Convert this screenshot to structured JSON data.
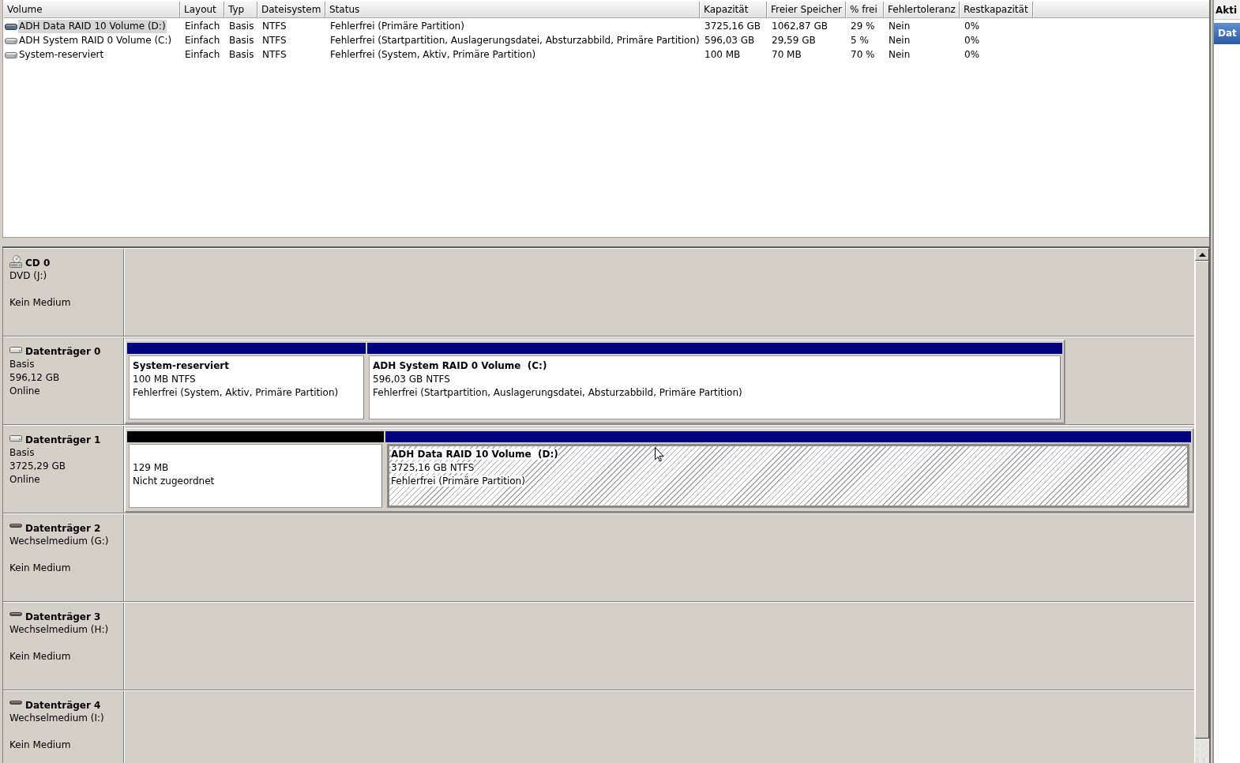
{
  "volume_list": {
    "columns": [
      "Volume",
      "Layout",
      "Typ",
      "Dateisystem",
      "Status",
      "Kapazität",
      "Freier Speicher",
      "% frei",
      "Fehlertoleranz",
      "Restkapazität"
    ],
    "rows": [
      {
        "selected": true,
        "cells": [
          "ADH Data RAID 10 Volume (D:)",
          "Einfach",
          "Basis",
          "NTFS",
          "Fehlerfrei (Primäre Partition)",
          "3725,16 GB",
          "1062,87 GB",
          "29 %",
          "Nein",
          "0%"
        ]
      },
      {
        "selected": false,
        "cells": [
          "ADH System RAID 0 Volume (C:)",
          "Einfach",
          "Basis",
          "NTFS",
          "Fehlerfrei (Startpartition, Auslagerungsdatei, Absturzabbild, Primäre Partition)",
          "596,03 GB",
          "29,59 GB",
          "5 %",
          "Nein",
          "0%"
        ]
      },
      {
        "selected": false,
        "cells": [
          "System-reserviert",
          "Einfach",
          "Basis",
          "NTFS",
          "Fehlerfrei (System, Aktiv, Primäre Partition)",
          "100 MB",
          "70 MB",
          "70 %",
          "Nein",
          "0%"
        ]
      }
    ]
  },
  "disks": [
    {
      "kind": "cdrom",
      "name": "CD 0",
      "type": "DVD (J:)",
      "status": "Kein Medium"
    },
    {
      "kind": "basic",
      "name": "Datenträger 0",
      "type": "Basis",
      "size": "596,12 GB",
      "status": "Online",
      "partitions": [
        {
          "kind": "primary",
          "selected": false,
          "name": "System-reserviert",
          "size": "100 MB NTFS",
          "status": "Fehlerfrei (System, Aktiv, Primäre Partition)"
        },
        {
          "kind": "primary",
          "selected": false,
          "name": "ADH System RAID 0 Volume  (C:)",
          "size": "596,03 GB NTFS",
          "status": "Fehlerfrei (Startpartition, Auslagerungsdatei, Absturzabbild, Primäre Partition)"
        }
      ]
    },
    {
      "kind": "basic",
      "name": "Datenträger 1",
      "type": "Basis",
      "size": "3725,29 GB",
      "status": "Online",
      "partitions": [
        {
          "kind": "unallocated",
          "selected": false,
          "size": "129 MB",
          "status": "Nicht zugeordnet"
        },
        {
          "kind": "primary",
          "selected": true,
          "name": "ADH Data RAID 10 Volume  (D:)",
          "size": "3725,16 GB NTFS",
          "status": "Fehlerfrei (Primäre Partition)"
        }
      ]
    },
    {
      "kind": "removable",
      "name": "Datenträger 2",
      "type": "Wechselmedium (G:)",
      "status": "Kein Medium"
    },
    {
      "kind": "removable",
      "name": "Datenträger 3",
      "type": "Wechselmedium (H:)",
      "status": "Kein Medium"
    },
    {
      "kind": "removable",
      "name": "Datenträger 4",
      "type": "Wechselmedium (I:)",
      "status": "Kein Medium"
    }
  ],
  "actions_pane": {
    "title": "Akti",
    "items": [
      "Dat"
    ]
  }
}
